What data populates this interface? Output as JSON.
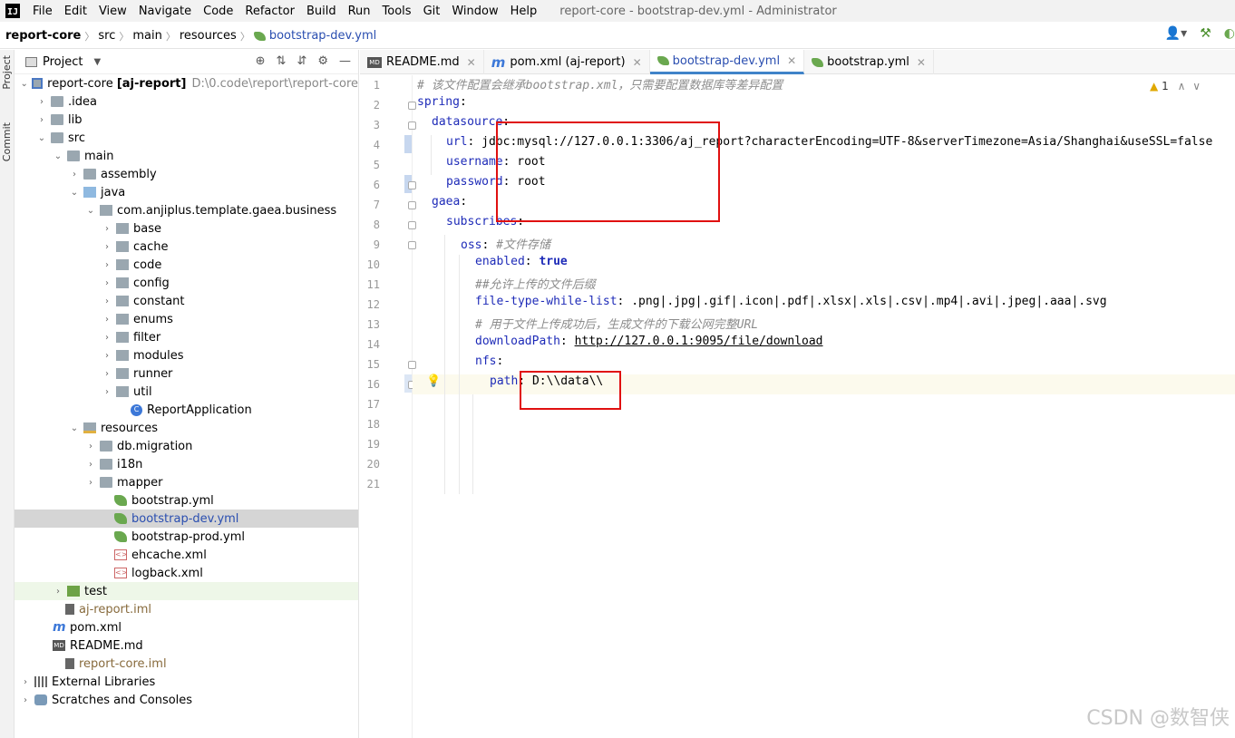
{
  "menubar": {
    "logo": "IJ",
    "items": [
      "File",
      "Edit",
      "View",
      "Navigate",
      "Code",
      "Refactor",
      "Build",
      "Run",
      "Tools",
      "Git",
      "Window",
      "Help"
    ],
    "title": "report-core - bootstrap-dev.yml - Administrator"
  },
  "breadcrumb": [
    "report-core",
    "src",
    "main",
    "resources",
    "bootstrap-dev.yml"
  ],
  "stripe": {
    "project": "Project",
    "commit": "Commit"
  },
  "panel": {
    "title": "Project"
  },
  "tree": [
    {
      "label": "report-core",
      "bold": "[aj-report]",
      "path": "D:\\0.code\\report\\report-core"
    },
    {
      "label": ".idea"
    },
    {
      "label": "lib"
    },
    {
      "label": "src"
    },
    {
      "label": "main"
    },
    {
      "label": "assembly"
    },
    {
      "label": "java"
    },
    {
      "label": "com.anjiplus.template.gaea.business"
    },
    {
      "label": "base"
    },
    {
      "label": "cache"
    },
    {
      "label": "code"
    },
    {
      "label": "config"
    },
    {
      "label": "constant"
    },
    {
      "label": "enums"
    },
    {
      "label": "filter"
    },
    {
      "label": "modules"
    },
    {
      "label": "runner"
    },
    {
      "label": "util"
    },
    {
      "label": "ReportApplication"
    },
    {
      "label": "resources"
    },
    {
      "label": "db.migration"
    },
    {
      "label": "i18n"
    },
    {
      "label": "mapper"
    },
    {
      "label": "bootstrap.yml"
    },
    {
      "label": "bootstrap-dev.yml"
    },
    {
      "label": "bootstrap-prod.yml"
    },
    {
      "label": "ehcache.xml"
    },
    {
      "label": "logback.xml"
    },
    {
      "label": "test"
    },
    {
      "label": "aj-report.iml"
    },
    {
      "label": "pom.xml"
    },
    {
      "label": "README.md"
    },
    {
      "label": "report-core.iml"
    },
    {
      "label": "External Libraries"
    },
    {
      "label": "Scratches and Consoles"
    }
  ],
  "tabs": [
    {
      "label": "README.md"
    },
    {
      "label": "pom.xml (aj-report)"
    },
    {
      "label": "bootstrap-dev.yml"
    },
    {
      "label": "bootstrap.yml"
    }
  ],
  "line_numbers": [
    "1",
    "2",
    "3",
    "4",
    "5",
    "6",
    "7",
    "8",
    "9",
    "10",
    "11",
    "12",
    "13",
    "14",
    "15",
    "16",
    "17",
    "18",
    "19",
    "20",
    "21"
  ],
  "code": {
    "l1": "# 该文件配置会继承bootstrap.xml，只需要配置数据库等差异配置",
    "l2k": "spring",
    "l2v": ":",
    "l3k": "datasource",
    "l3v": ":",
    "l4k": "url",
    "l4v": ": jdbc:mysql://127.0.0.1:3306/aj_report?characterEncoding=UTF-8&serverTimezone=Asia/Shanghai&useSSL=false",
    "l5k": "username",
    "l5v": ": root",
    "l6k": "password",
    "l6v": ": root",
    "l7k": "gaea",
    "l7v": ":",
    "l8k": "subscribes",
    "l8v": ":",
    "l9k": "oss",
    "l9v": ": ",
    "l9c": "#文件存储",
    "l10k": "enabled",
    "l10v": ": ",
    "l10b": "true",
    "l11": "##允许上传的文件后缀",
    "l12k": "file-type-while-list",
    "l12v": ": .png|.jpg|.gif|.icon|.pdf|.xlsx|.xls|.csv|.mp4|.avi|.jpeg|.aaa|.svg",
    "l13": "# 用于文件上传成功后，生成文件的下载公网完整URL",
    "l14k": "downloadPath",
    "l14v": ": ",
    "l14l": "http://127.0.0.1:9095/file/download",
    "l15k": "nfs",
    "l15v": ":",
    "l16k": "path",
    "l16v": ": D:\\\\data\\\\"
  },
  "inspection": {
    "count": "1"
  },
  "watermark": "CSDN @数智侠"
}
